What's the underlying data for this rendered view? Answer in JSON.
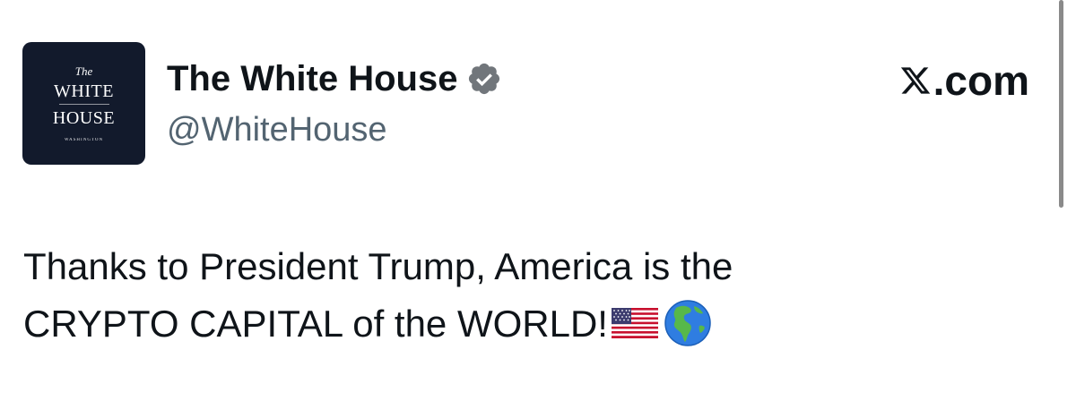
{
  "avatar": {
    "line1": "The",
    "line2": "WHITE",
    "line3": "HOUSE",
    "line4": "WASHINGTON",
    "background": "#121a2c"
  },
  "author": {
    "display_name": "The White House",
    "handle": "@WhiteHouse",
    "verified": true,
    "verified_color": "#71767b"
  },
  "site": {
    "label": ".com"
  },
  "tweet": {
    "line1": "Thanks to President Trump, America is the",
    "line2": "CRYPTO CAPITAL of the WORLD!",
    "emojis": [
      "us-flag-emoji",
      "globe-americas-emoji"
    ]
  },
  "colors": {
    "text": "#0f1419",
    "handle": "#536471",
    "background": "#ffffff"
  }
}
